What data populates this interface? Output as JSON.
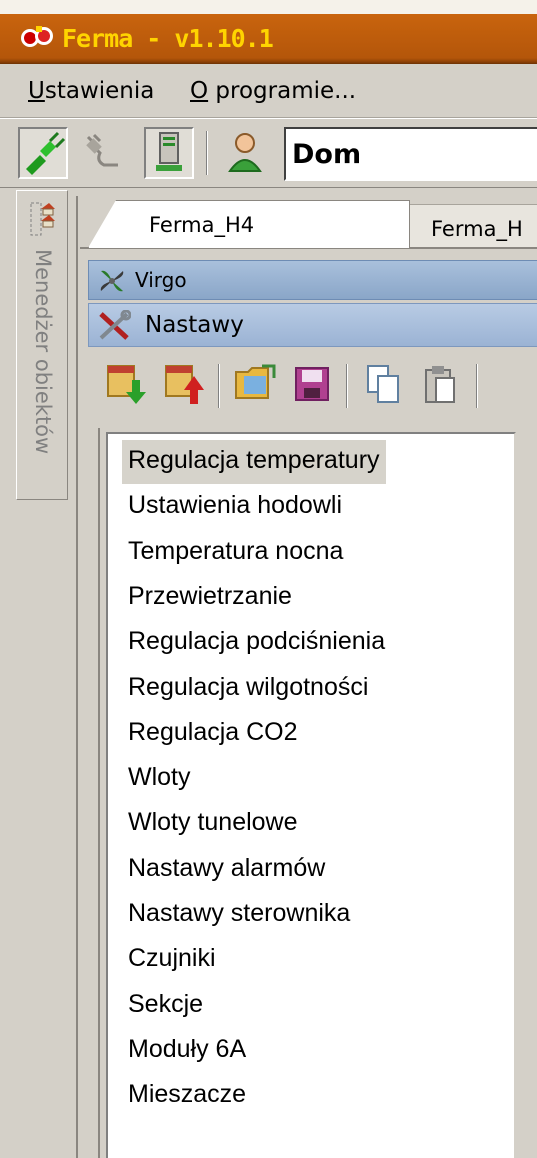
{
  "window": {
    "title": "Ferma - v1.10.1",
    "icon": "app-logo-icon"
  },
  "menu": {
    "items": [
      {
        "first": "U",
        "rest": "stawienia"
      },
      {
        "first": "O",
        "rest": " programie..."
      }
    ]
  },
  "toolbar": {
    "icons": [
      "connect-icon",
      "disconnect-icon",
      "computer-icon",
      "user-icon"
    ],
    "profile": "Dom"
  },
  "sidebar": {
    "label": "Menedżer obiektów",
    "icon": "object-tree-icon"
  },
  "tabs": [
    {
      "label": "Ferma_H4",
      "active": true
    },
    {
      "label": "Ferma_H",
      "active": false
    }
  ],
  "panels": {
    "device": "Virgo",
    "section": "Nastawy"
  },
  "inner_toolbar": {
    "icons": [
      "download-icon",
      "upload-icon",
      "open-folder-icon",
      "save-icon",
      "copy-icon",
      "paste-icon"
    ]
  },
  "settings_list": {
    "selected_index": 0,
    "items": [
      "Regulacja temperatury",
      "Ustawienia hodowli",
      "Temperatura nocna",
      "Przewietrzanie",
      "Regulacja podciśnienia",
      "Regulacja wilgotności",
      "Regulacja CO2",
      "Wloty",
      "Wloty tunelowe",
      "Nastawy alarmów",
      "Nastawy sterownika",
      "Czujniki",
      "Sekcje",
      "Moduły 6A",
      "Mieszacze"
    ]
  },
  "colors": {
    "title_bar": "#b4560a",
    "title_text": "#ffd400",
    "panel_header": "#9bb3d4",
    "selection": "#d6d3cb"
  }
}
